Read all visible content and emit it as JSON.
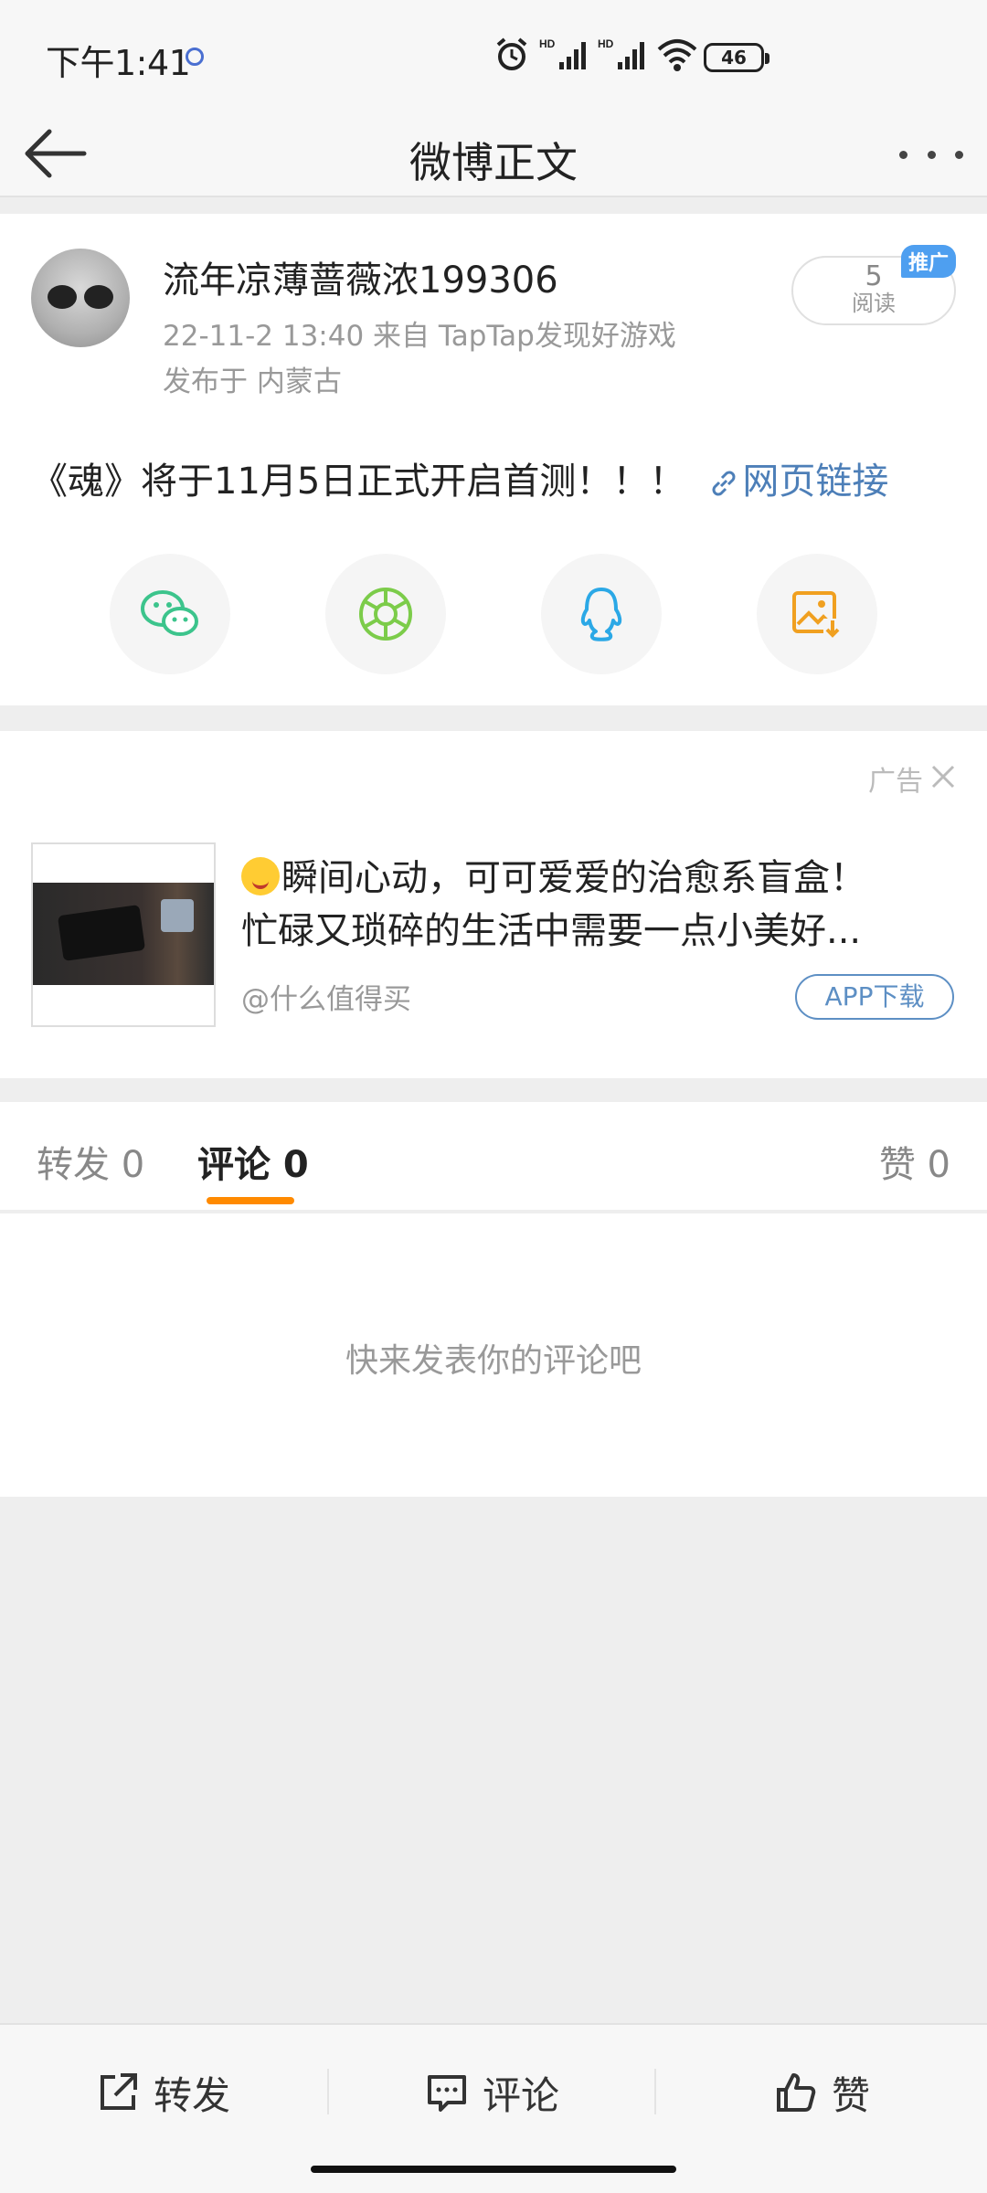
{
  "status_bar": {
    "time": "下午1:41",
    "battery": "46",
    "icons": [
      "alarm-icon",
      "hd-signal-icon",
      "hd-signal-icon",
      "wifi-icon",
      "battery-icon"
    ]
  },
  "header": {
    "title": "微博正文",
    "back_icon": "back-arrow-icon",
    "more_icon": "more-icon"
  },
  "post": {
    "username": "流年凉薄蔷薇浓199306",
    "meta": "22-11-2 13:40   来自 TapTap发现好游戏",
    "location": "发布于 内蒙古",
    "read_count": "5",
    "read_label": "阅读",
    "promo_tag": "推广",
    "text": "《魂》将于11月5日正式开启首测！！！",
    "link_text": "网页链接",
    "share_targets": [
      "wechat-icon",
      "moments-icon",
      "qq-icon",
      "save-image-icon"
    ]
  },
  "ad": {
    "label": "广告",
    "title_line1": "瞬间心动，可可爱爱的治愈系盲盒！",
    "title_line2": "忙碌又琐碎的生活中需要一点小美好...",
    "source": "@什么值得买",
    "download_label": "APP下载"
  },
  "tabs": {
    "repost": "转发 0",
    "comment": "评论 0",
    "like": "赞 0"
  },
  "comments": {
    "empty_hint": "快来发表你的评论吧"
  },
  "bottom_bar": {
    "repost": "转发",
    "comment": "评论",
    "like": "赞"
  },
  "colors": {
    "accent_orange": "#ff8a00",
    "link_blue": "#4d7fb8",
    "promo_blue": "#4e9ff0"
  }
}
